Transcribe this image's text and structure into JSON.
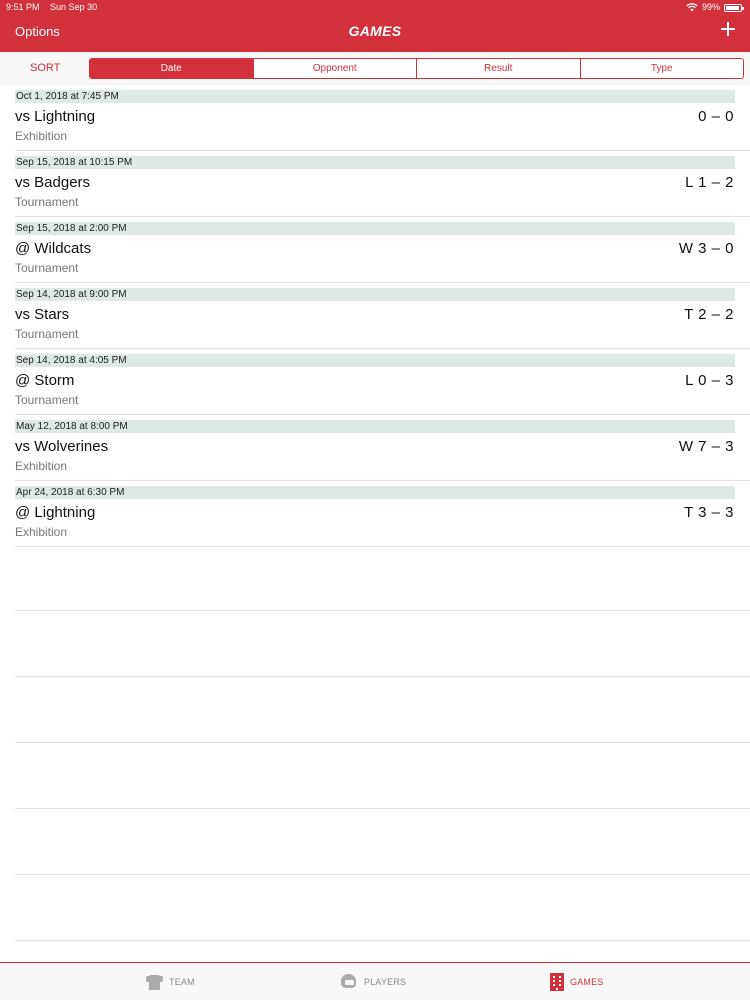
{
  "status_bar": {
    "time": "9:51 PM",
    "date": "Sun Sep 30",
    "battery": "99%"
  },
  "header": {
    "options_label": "Options",
    "title": "GAMES",
    "add_icon": "plus-icon"
  },
  "sort": {
    "label": "SORT",
    "segments": [
      "Date",
      "Opponent",
      "Result",
      "Type"
    ],
    "active_segment": "Date"
  },
  "games": [
    {
      "date": "Oct 1, 2018 at 7:45 PM",
      "opponent": "vs Lightning",
      "type": "Exhibition",
      "result": "0 – 0"
    },
    {
      "date": "Sep 15, 2018 at 10:15 PM",
      "opponent": "vs Badgers",
      "type": "Tournament",
      "result": "L 1 – 2"
    },
    {
      "date": "Sep 15, 2018 at 2:00 PM",
      "opponent": "@ Wildcats",
      "type": "Tournament",
      "result": "W 3 – 0"
    },
    {
      "date": "Sep 14, 2018 at 9:00 PM",
      "opponent": "vs Stars",
      "type": "Tournament",
      "result": "T 2 – 2"
    },
    {
      "date": "Sep 14, 2018 at 4:05 PM",
      "opponent": "@ Storm",
      "type": "Tournament",
      "result": "L 0 – 3"
    },
    {
      "date": "May 12, 2018 at 8:00 PM",
      "opponent": "vs Wolverines",
      "type": "Exhibition",
      "result": "W 7 – 3"
    },
    {
      "date": "Apr 24, 2018 at 6:30 PM",
      "opponent": "@ Lightning",
      "type": "Exhibition",
      "result": "T 3 – 3"
    }
  ],
  "tab_bar": {
    "tabs": [
      {
        "label": "TEAM",
        "icon": "jersey-icon"
      },
      {
        "label": "PLAYERS",
        "icon": "helmet-icon"
      },
      {
        "label": "GAMES",
        "icon": "scoreboard-icon"
      }
    ],
    "active_tab": "GAMES"
  },
  "colors": {
    "accent": "#d2313b",
    "date_band": "#dde8e7"
  }
}
